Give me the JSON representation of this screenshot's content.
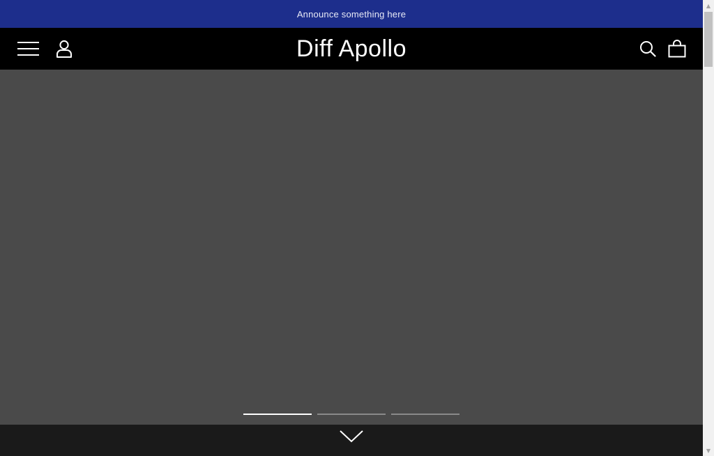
{
  "announcement": {
    "text": "Announce something here"
  },
  "header": {
    "logo": "Diff Apollo",
    "icons": {
      "menu": "hamburger-menu-icon",
      "account": "user-account-icon",
      "search": "search-icon",
      "cart": "shopping-bag-icon"
    }
  },
  "hero": {
    "slide_count": 3,
    "active_slide": 1,
    "scroll_icon": "chevron-down-icon"
  },
  "colors": {
    "announce_bg": "#1d2e8c",
    "announce_text": "#e8eaf6",
    "header_bg": "#000000",
    "header_text": "#ffffff",
    "hero_bg": "#4a4a4a",
    "dot_active": "#ffffff",
    "dot_inactive": "#8a8a8a",
    "footer_bg": "#1a1a1a"
  }
}
